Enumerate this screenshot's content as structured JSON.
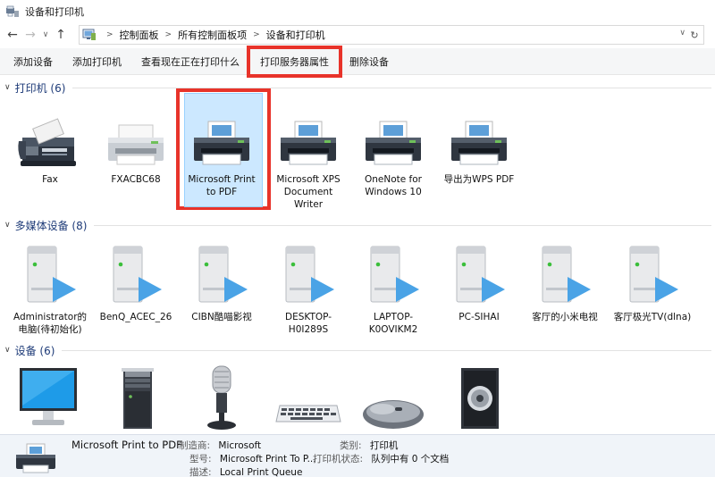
{
  "window": {
    "title": "设备和打印机"
  },
  "address": {
    "crumbs": [
      "控制面板",
      "所有控制面板项",
      "设备和打印机"
    ]
  },
  "toolbar": {
    "buttons": [
      "添加设备",
      "添加打印机",
      "查看现在正在打印什么",
      "打印服务器属性",
      "删除设备"
    ]
  },
  "sections": {
    "printers": {
      "label": "打印机 (6)",
      "items": [
        "Fax",
        "FXACBC68",
        "Microsoft Print to PDF",
        "Microsoft XPS Document Writer",
        "OneNote for Windows 10",
        "导出为WPS PDF"
      ]
    },
    "media": {
      "label": "多媒体设备 (8)",
      "items": [
        "Administrator的电脑(待初始化)",
        "BenQ_ACEC_26",
        "CIBN酷喵影视",
        "DESKTOP-H0I289S",
        "LAPTOP-K0OVIKM2",
        "PC-SIHAI",
        "客厅的小米电视",
        "客厅极光TV(dlna)"
      ]
    },
    "devices": {
      "label": "设备 (6)"
    }
  },
  "details": {
    "name": "Microsoft Print to PDF",
    "manufacturer_label": "制造商:",
    "manufacturer": "Microsoft",
    "model_label": "型号:",
    "model": "Microsoft Print To P...",
    "description_label": "描述:",
    "description": "Local Print Queue",
    "category_label": "类别:",
    "category": "打印机",
    "status_label": "打印机状态:",
    "status": "队列中有 0 个文档"
  },
  "colors": {
    "highlight_red": "#e8332a",
    "selection_fill": "#cce8ff",
    "section_label": "#1e3b78"
  }
}
